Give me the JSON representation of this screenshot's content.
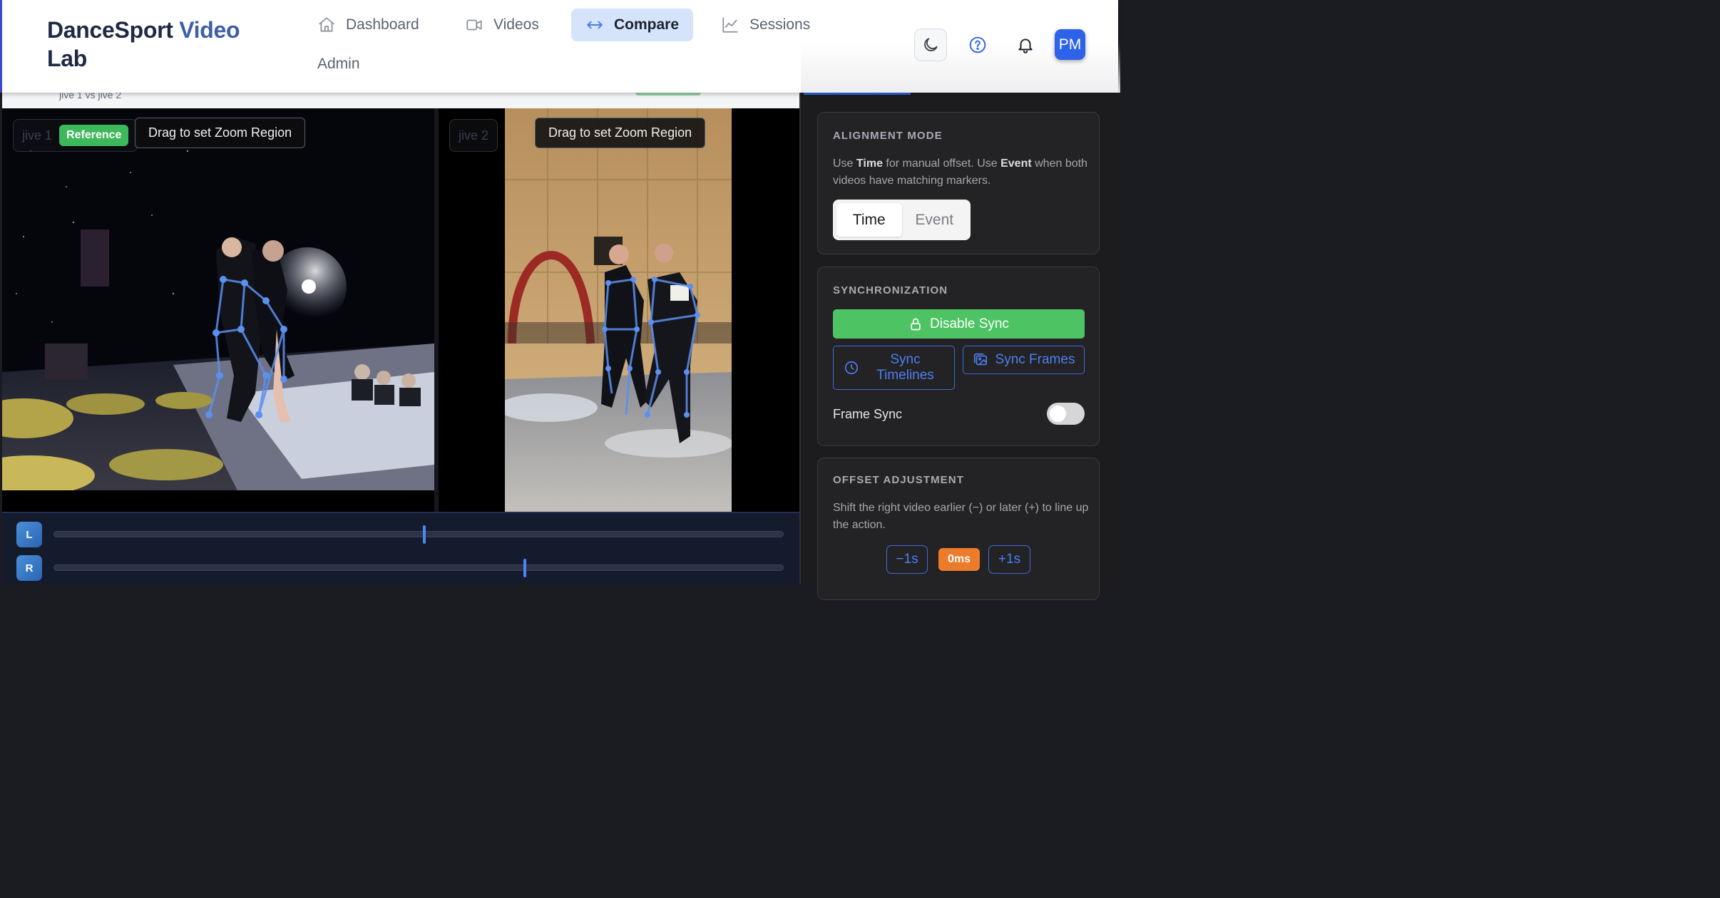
{
  "app": {
    "brand_part1": "DanceSport ",
    "brand_part2": "Video",
    "brand_part3": "Lab"
  },
  "nav": {
    "dashboard": "Dashboard",
    "videos": "Videos",
    "compare": "Compare",
    "sessions": "Sessions",
    "admin": "Admin",
    "active": "Compare"
  },
  "user": {
    "initials": "PM"
  },
  "page": {
    "subtitle": "jive 1 vs jive 2"
  },
  "videos": {
    "left": {
      "name": "jive 1",
      "badge": "Reference",
      "zoom_hint": "Drag to set Zoom Region"
    },
    "right": {
      "name": "jive 2",
      "zoom_hint": "Drag to set Zoom Region"
    }
  },
  "timeline": {
    "left_label": "L",
    "right_label": "R",
    "left_position_fraction": 0.507,
    "right_position_fraction": 0.645
  },
  "alignment": {
    "title": "ALIGNMENT MODE",
    "desc_pre": "Use ",
    "desc_time": "Time",
    "desc_mid": " for manual offset. Use ",
    "desc_event": "Event",
    "desc_post": " when both videos have matching markers.",
    "option_time": "Time",
    "option_event": "Event",
    "selected": "Time"
  },
  "sync": {
    "title": "SYNCHRONIZATION",
    "disable_label": "Disable Sync",
    "sync_timelines_label": "Sync Timelines",
    "sync_frames_label": "Sync Frames",
    "frame_sync_label": "Frame Sync",
    "frame_sync_on": false
  },
  "offset": {
    "title": "OFFSET ADJUSTMENT",
    "desc": "Shift the right video earlier (−) or later (+) to line up the action.",
    "minus_label": "−1s",
    "value": "0ms",
    "plus_label": "+1s"
  },
  "colors": {
    "accent": "#2d63e8",
    "success": "#4ec363",
    "offset_badge": "#ed7b2c",
    "active_nav": "#d6e4fb"
  }
}
